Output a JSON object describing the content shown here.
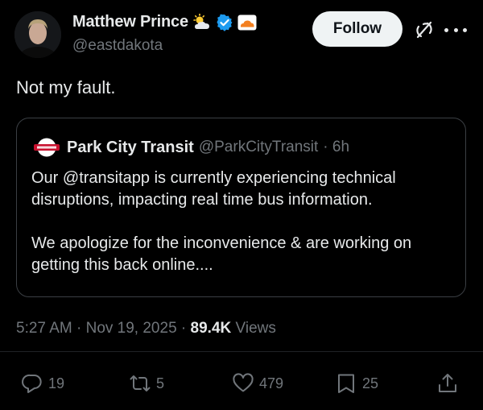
{
  "author": {
    "name": "Matthew Prince",
    "handle": "@eastdakota",
    "badge_icons": [
      "sun-behind-cloud-icon",
      "verified-icon",
      "cloudflare-logo-icon"
    ]
  },
  "follow_label": "Follow",
  "tweet_text": "Not my fault.",
  "quote": {
    "name": "Park City Transit",
    "handle": "@ParkCityTransit",
    "time": "· 6h",
    "paragraphs": [
      "Our @transitapp is currently experiencing technical disruptions, impacting real time bus information.",
      "We apologize for the inconvenience & are working on getting this back online...."
    ]
  },
  "meta": {
    "time": "5:27 AM",
    "date": "Nov 19, 2025",
    "sep": "·",
    "views_count": "89.4K",
    "views_label": "Views"
  },
  "actions": {
    "replies": "19",
    "reposts": "5",
    "likes": "479",
    "bookmarks": "25"
  },
  "colors": {
    "background": "#000000",
    "text": "#e7e9ea",
    "muted": "#71767b",
    "verified": "#1d9bf0",
    "cloudflare": "#f38020"
  }
}
